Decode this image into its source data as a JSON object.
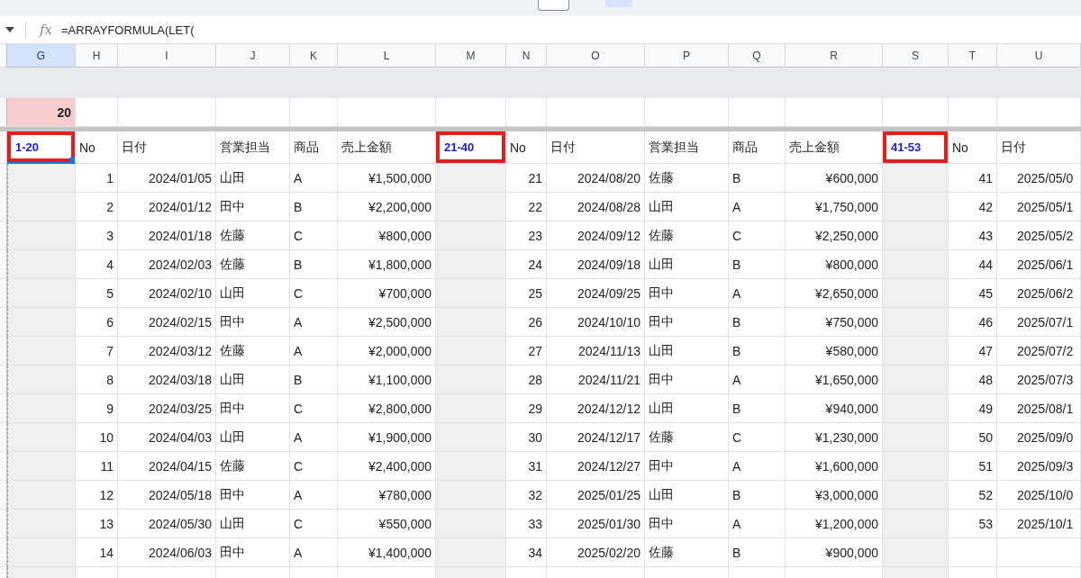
{
  "formula_bar": {
    "fx": "fx",
    "formula": "=ARRAYFORMULA(LET("
  },
  "column_headers": [
    {
      "label": "G",
      "selected": true
    },
    {
      "label": "H",
      "selected": false
    },
    {
      "label": "I",
      "selected": false
    },
    {
      "label": "J",
      "selected": false
    },
    {
      "label": "K",
      "selected": false
    },
    {
      "label": "L",
      "selected": false
    },
    {
      "label": "M",
      "selected": false
    },
    {
      "label": "N",
      "selected": false
    },
    {
      "label": "O",
      "selected": false
    },
    {
      "label": "P",
      "selected": false
    },
    {
      "label": "Q",
      "selected": false
    },
    {
      "label": "R",
      "selected": false
    },
    {
      "label": "S",
      "selected": false
    },
    {
      "label": "T",
      "selected": false
    },
    {
      "label": "U",
      "selected": false
    }
  ],
  "count_cell": "20",
  "blocks": [
    {
      "range_label": "1-20",
      "boxed": true,
      "selected": true,
      "headers": [
        "No",
        "日付",
        "営業担当",
        "商品",
        "売上金額"
      ],
      "rows": [
        [
          "1",
          "2024/01/05",
          "山田",
          "A",
          "¥1,500,000"
        ],
        [
          "2",
          "2024/01/12",
          "田中",
          "B",
          "¥2,200,000"
        ],
        [
          "3",
          "2024/01/18",
          "佐藤",
          "C",
          "¥800,000"
        ],
        [
          "4",
          "2024/02/03",
          "佐藤",
          "B",
          "¥1,800,000"
        ],
        [
          "5",
          "2024/02/10",
          "山田",
          "C",
          "¥700,000"
        ],
        [
          "6",
          "2024/02/15",
          "田中",
          "A",
          "¥2,500,000"
        ],
        [
          "7",
          "2024/03/12",
          "佐藤",
          "A",
          "¥2,000,000"
        ],
        [
          "8",
          "2024/03/18",
          "山田",
          "B",
          "¥1,100,000"
        ],
        [
          "9",
          "2024/03/25",
          "田中",
          "C",
          "¥2,800,000"
        ],
        [
          "10",
          "2024/04/03",
          "山田",
          "A",
          "¥1,900,000"
        ],
        [
          "11",
          "2024/04/15",
          "佐藤",
          "C",
          "¥2,400,000"
        ],
        [
          "12",
          "2024/05/18",
          "田中",
          "A",
          "¥780,000"
        ],
        [
          "13",
          "2024/05/30",
          "山田",
          "C",
          "¥550,000"
        ],
        [
          "14",
          "2024/06/03",
          "田中",
          "A",
          "¥1,400,000"
        ]
      ]
    },
    {
      "range_label": "21-40",
      "boxed": true,
      "selected": false,
      "headers": [
        "No",
        "日付",
        "営業担当",
        "商品",
        "売上金額"
      ],
      "rows": [
        [
          "21",
          "2024/08/20",
          "佐藤",
          "B",
          "¥600,000"
        ],
        [
          "22",
          "2024/08/28",
          "山田",
          "A",
          "¥1,750,000"
        ],
        [
          "23",
          "2024/09/12",
          "佐藤",
          "C",
          "¥2,250,000"
        ],
        [
          "24",
          "2024/09/18",
          "山田",
          "B",
          "¥800,000"
        ],
        [
          "25",
          "2024/09/25",
          "田中",
          "A",
          "¥2,650,000"
        ],
        [
          "26",
          "2024/10/10",
          "田中",
          "B",
          "¥750,000"
        ],
        [
          "27",
          "2024/11/13",
          "山田",
          "B",
          "¥580,000"
        ],
        [
          "28",
          "2024/11/21",
          "田中",
          "A",
          "¥1,650,000"
        ],
        [
          "29",
          "2024/12/12",
          "山田",
          "B",
          "¥940,000"
        ],
        [
          "30",
          "2024/12/17",
          "佐藤",
          "C",
          "¥1,230,000"
        ],
        [
          "31",
          "2024/12/27",
          "田中",
          "A",
          "¥1,600,000"
        ],
        [
          "32",
          "2025/01/25",
          "山田",
          "B",
          "¥3,000,000"
        ],
        [
          "33",
          "2025/01/30",
          "田中",
          "A",
          "¥1,200,000"
        ],
        [
          "34",
          "2025/02/20",
          "佐藤",
          "B",
          "¥900,000"
        ]
      ]
    },
    {
      "range_label": "41-53",
      "boxed": true,
      "selected": false,
      "headers": [
        "No",
        "日付"
      ],
      "rows": [
        [
          "41",
          "2025/05/0"
        ],
        [
          "42",
          "2025/05/1"
        ],
        [
          "43",
          "2025/05/2"
        ],
        [
          "44",
          "2025/06/1"
        ],
        [
          "45",
          "2025/06/2"
        ],
        [
          "46",
          "2025/07/1"
        ],
        [
          "47",
          "2025/07/2"
        ],
        [
          "48",
          "2025/07/3"
        ],
        [
          "49",
          "2025/08/1"
        ],
        [
          "50",
          "2025/09/0"
        ],
        [
          "51",
          "2025/09/3"
        ],
        [
          "52",
          "2025/10/0"
        ],
        [
          "53",
          "2025/10/1"
        ]
      ]
    }
  ]
}
